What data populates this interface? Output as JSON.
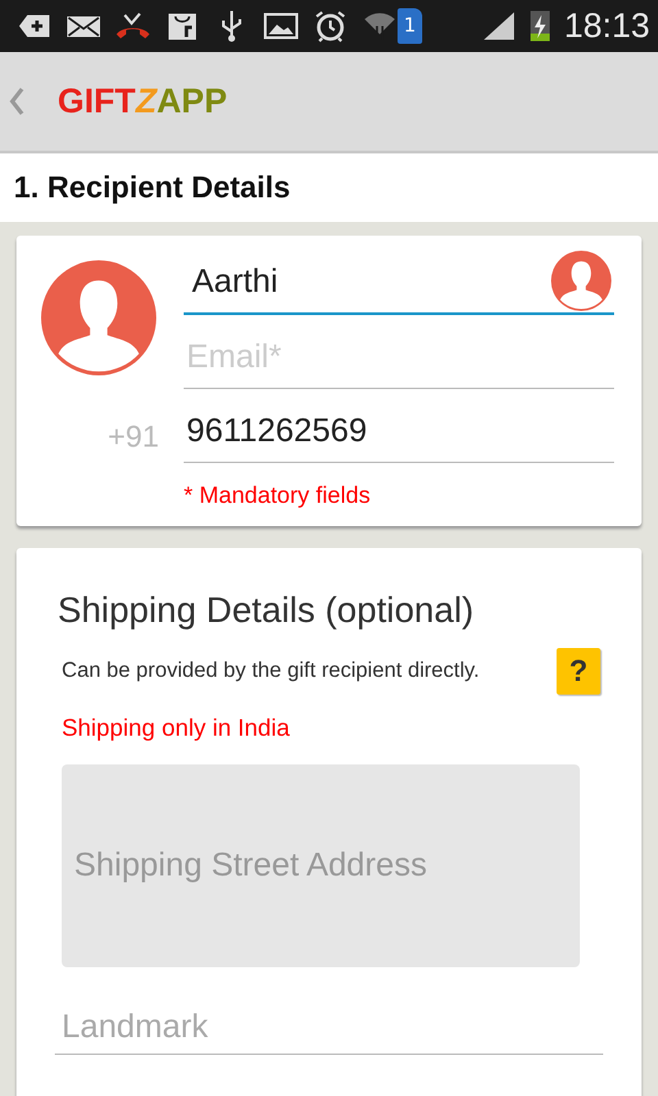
{
  "status_bar": {
    "sim_badge": "1",
    "time": "18:13"
  },
  "app_bar": {
    "logo": [
      {
        "text": "GIFT",
        "color": "#e8231c"
      },
      {
        "text": "Z",
        "color": "#f39a1e"
      },
      {
        "text": "APP",
        "color": "#7f8a12"
      }
    ]
  },
  "section_title": "1. Recipient Details",
  "recipient": {
    "name": {
      "value": "Aarthi",
      "focused": true
    },
    "email": {
      "placeholder": "Email*"
    },
    "phone": {
      "prefix": "+91",
      "value": "9611262569"
    },
    "note": "* Mandatory fields"
  },
  "shipping": {
    "title": "Shipping Details (optional)",
    "subtitle": "Can be provided by the gift recipient directly.",
    "help": "?",
    "notice": "Shipping only in India",
    "street": {
      "placeholder": "Shipping Street Address"
    },
    "landmark": {
      "placeholder": "Landmark"
    }
  }
}
